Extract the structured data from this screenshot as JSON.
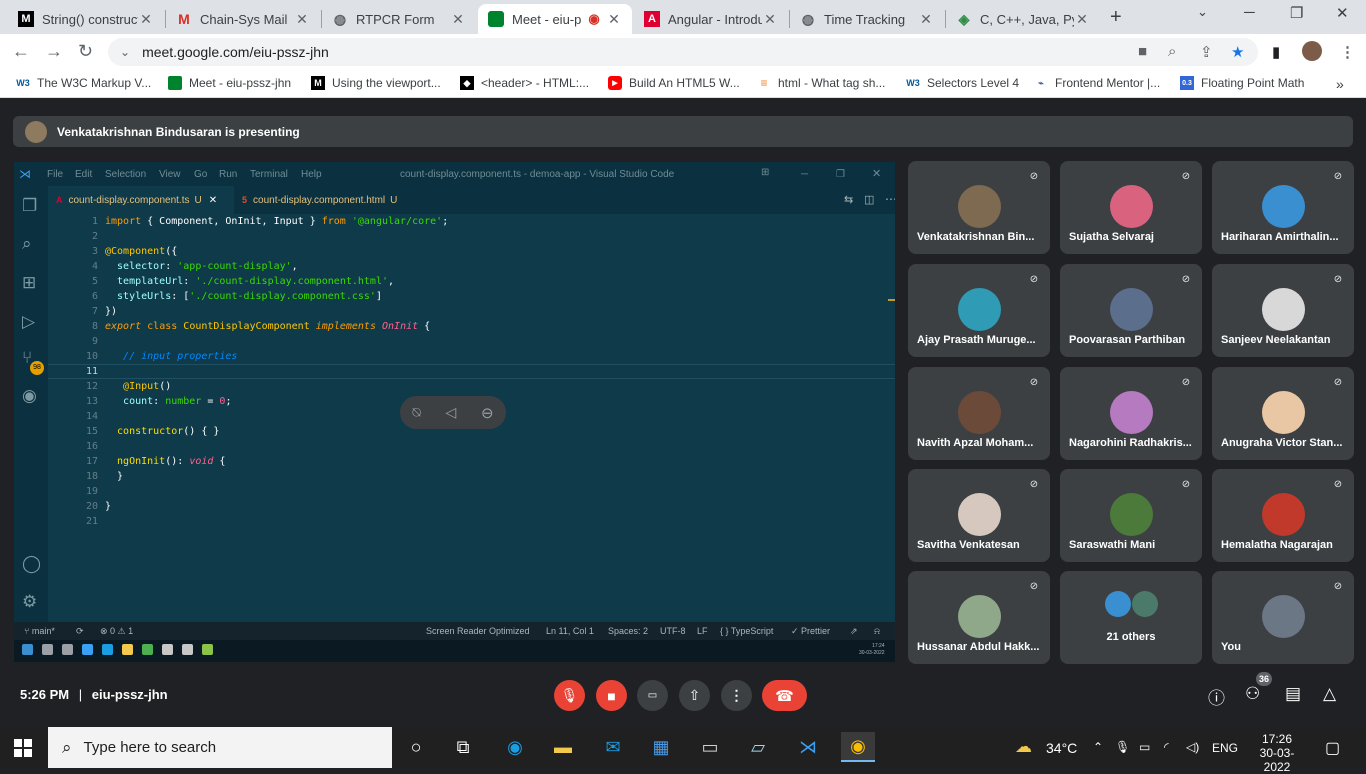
{
  "tabs": [
    {
      "title": "String() construct",
      "favicon": "M",
      "color": "#000000"
    },
    {
      "title": "Chain-Sys Mail",
      "favicon": "M",
      "color": "#d93025"
    },
    {
      "title": "RTPCR Form",
      "favicon": "globe",
      "color": "#5f6368"
    },
    {
      "title": "Meet - eiu-p",
      "favicon": "meet",
      "color": "#00832d",
      "active": true
    },
    {
      "title": "Angular - Introdu",
      "favicon": "A",
      "color": "#dd0031"
    },
    {
      "title": "Time Tracking",
      "favicon": "globe",
      "color": "#5f6368"
    },
    {
      "title": "C, C++, Java, Pytl",
      "favicon": "diamond",
      "color": "#5f6368"
    }
  ],
  "address": {
    "url": "meet.google.com/eiu-pssz-jhn"
  },
  "bookmarks": [
    {
      "label": "The W3C Markup V...",
      "icon": "W3"
    },
    {
      "label": "Meet - eiu-pssz-jhn",
      "icon": "meet"
    },
    {
      "label": "Using the viewport...",
      "icon": "M"
    },
    {
      "label": "<header> - HTML:...",
      "icon": "mdn"
    },
    {
      "label": "Build An HTML5 W...",
      "icon": "youtube"
    },
    {
      "label": "html - What tag sh...",
      "icon": "stack"
    },
    {
      "label": "Selectors Level 4",
      "icon": "W3"
    },
    {
      "label": "Frontend Mentor |...",
      "icon": "fm"
    },
    {
      "label": "Floating Point Math",
      "icon": "0.3"
    }
  ],
  "meet": {
    "presenting": "Venkatakrishnan Bindusaran is presenting",
    "time": "5:26 PM",
    "meeting_code": "eiu-pssz-jhn",
    "people_count": "36"
  },
  "vscode": {
    "title": "count-display.component.ts - demoa-app - Visual Studio Code",
    "menu": [
      "File",
      "Edit",
      "Selection",
      "View",
      "Go",
      "Run",
      "Terminal",
      "Help"
    ],
    "tabs": [
      {
        "label": "count-display.component.ts",
        "badge": "U"
      },
      {
        "label": "count-display.component.html",
        "badge": "U"
      }
    ],
    "scm_badge": "98",
    "status": {
      "branch": "main*",
      "problems": "⊗ 0 ⚠ 1",
      "reader": "Screen Reader Optimized",
      "pos": "Ln 11, Col 1",
      "spaces": "Spaces: 2",
      "enc": "UTF-8",
      "eol": "LF",
      "lang": "{ } TypeScript",
      "prettier": "✓ Prettier"
    },
    "clock": {
      "time": "17:24",
      "date": "30-03-2022"
    }
  },
  "participants": [
    {
      "name": "Venkatakrishnan Bin...",
      "color": "#7d6a50"
    },
    {
      "name": "Sujatha Selvaraj",
      "color": "#d9627f"
    },
    {
      "name": "Hariharan Amirthalin...",
      "color": "#3a8fd1"
    },
    {
      "name": "Ajay Prasath Muruge...",
      "color": "#2f9bb4"
    },
    {
      "name": "Poovarasan Parthiban",
      "color": "#5b6e8c"
    },
    {
      "name": "Sanjeev Neelakantan",
      "color": "#d8d8d8"
    },
    {
      "name": "Navith Apzal Moham...",
      "color": "#6b4a3a"
    },
    {
      "name": "Nagarohini Radhakris...",
      "color": "#b57ac0"
    },
    {
      "name": "Anugraha Victor Stan...",
      "color": "#e9c6a4"
    },
    {
      "name": "Savitha Venkatesan",
      "color": "#d7c8bf"
    },
    {
      "name": "Saraswathi Mani",
      "color": "#4b7a3a"
    },
    {
      "name": "Hemalatha Nagarajan",
      "color": "#c0392b"
    },
    {
      "name": "Hussanar Abdul Hakk...",
      "color": "#8fa88a"
    },
    {
      "name": "21 others",
      "color": "#3a8fd1"
    },
    {
      "name": "You",
      "color": "#6b7785"
    }
  ],
  "taskbar": {
    "search_placeholder": "Type here to search",
    "weather": "34°C",
    "lang": "ENG",
    "time": "17:26",
    "date": "30-03-2022"
  }
}
